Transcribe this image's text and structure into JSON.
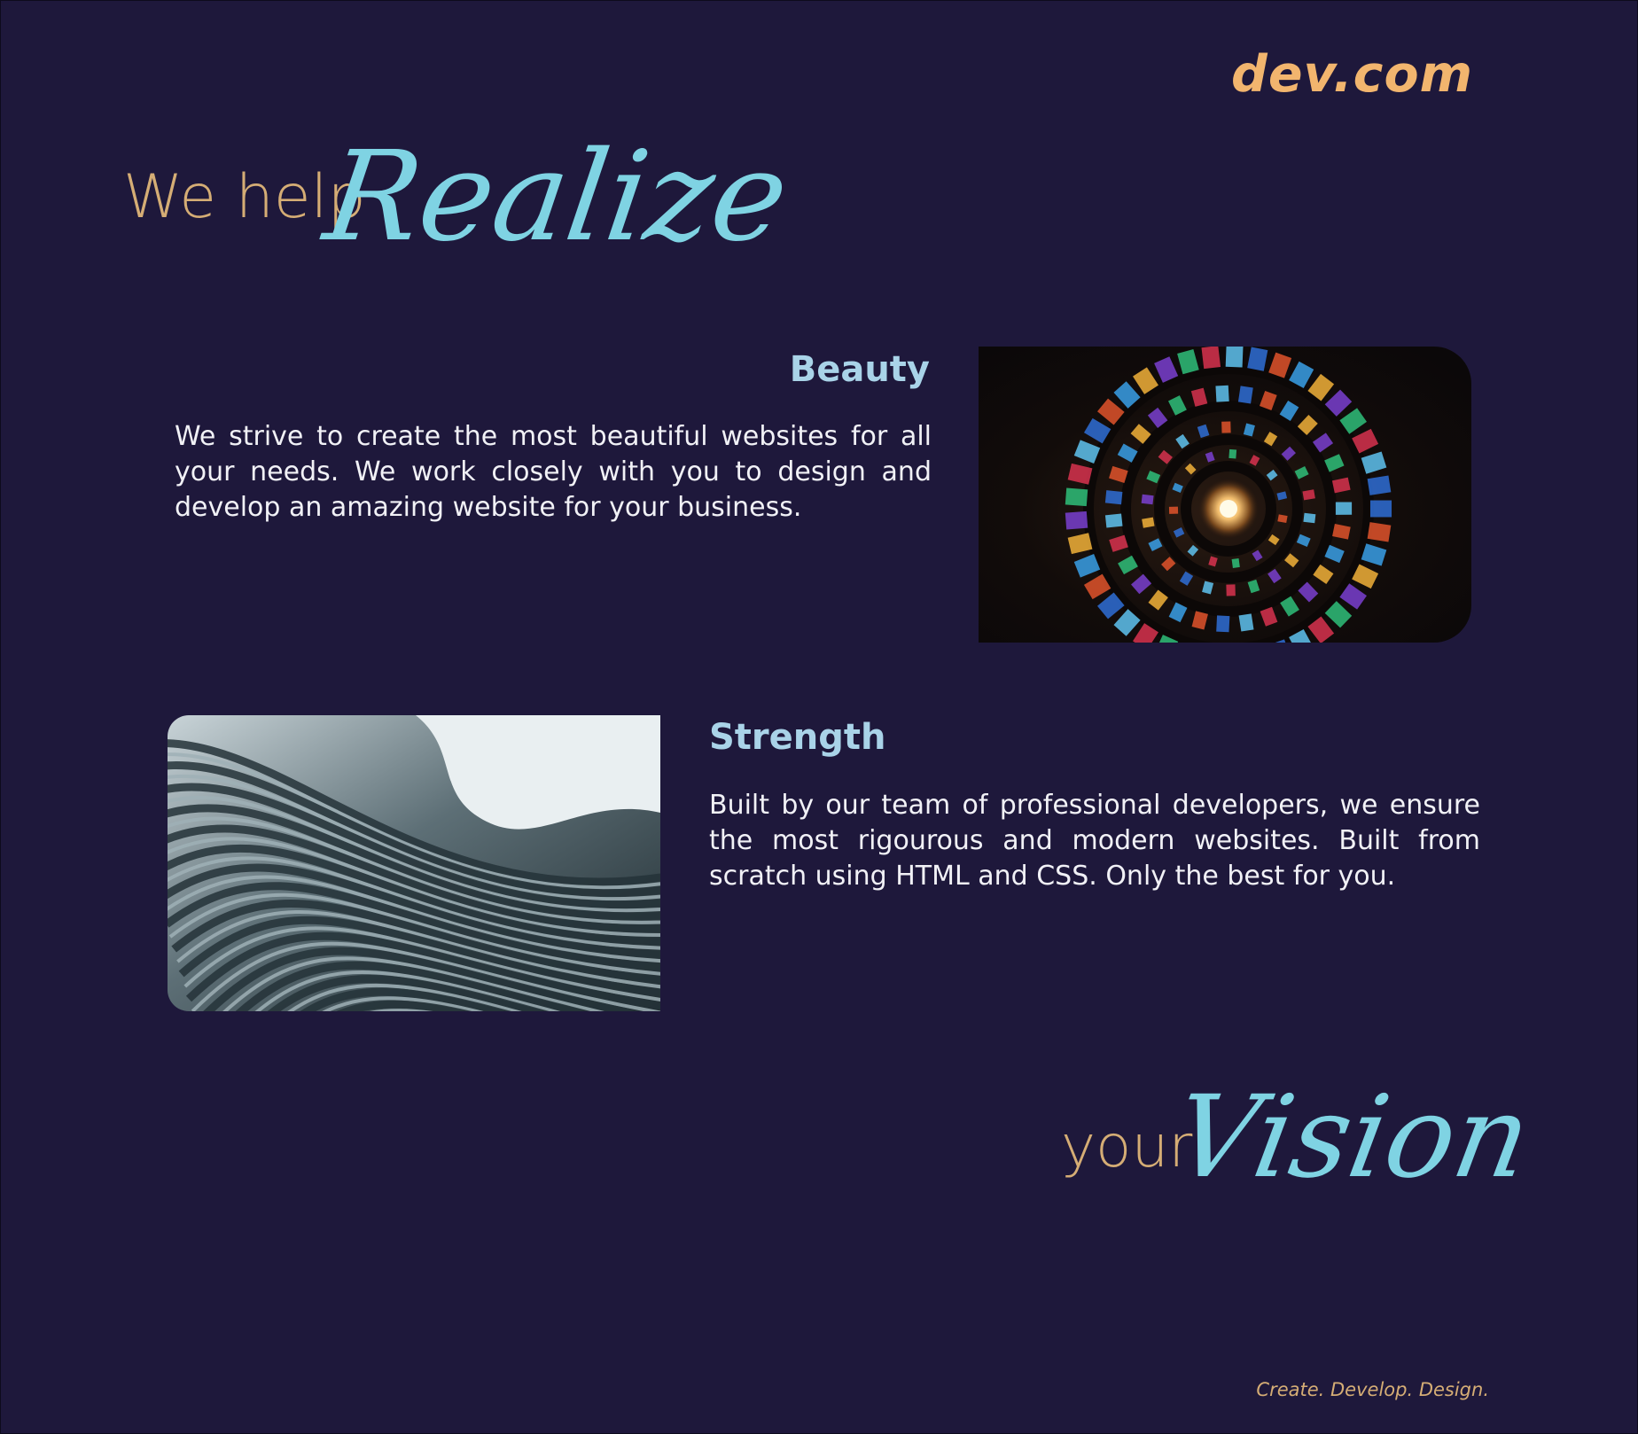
{
  "brand": {
    "logo": "dev.com",
    "accent_color": "#f2b56e",
    "script_color": "#7fd3e3",
    "background_color": "#1e183b"
  },
  "hero_top": {
    "lead": "We help",
    "script": "Realize"
  },
  "sections": {
    "beauty": {
      "title": "Beauty",
      "text": "We strive to create the most beautiful websites for all your needs. We work closely with you to design and develop an amazing website for your business.",
      "image_icon": "stained-glass-spiral-image"
    },
    "strength": {
      "title": "Strength",
      "text": "Built by our team of professional developers, we ensure the most rigourous and modern websites. Built from scratch using HTML and CSS. Only the best for you.",
      "image_icon": "curved-architecture-image"
    }
  },
  "hero_bottom": {
    "lead": "your",
    "script": "Vision"
  },
  "footer": {
    "tagline": "Create. Develop. Design."
  }
}
